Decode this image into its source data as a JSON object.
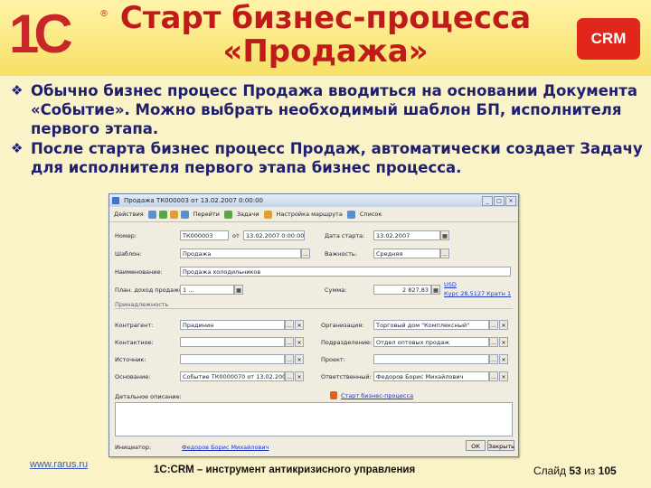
{
  "header": {
    "logo": "1С",
    "title_line1": "Старт бизнес-процесса",
    "title_line2": "«Продажа»",
    "badge": "CRM"
  },
  "bullets": [
    "Обычно бизнес процесс Продажа вводиться на основании Документа «Событие». Можно выбрать необходимый шаблон БП, исполнителя первого этапа.",
    "После старта бизнес процесс Продаж, автоматически создает Задачу для исполнителя первого этапа бизнес процесса."
  ],
  "window": {
    "title": "Продажа ТК000003 от 13.02.2007 0:00:00",
    "toolbar": {
      "actions": "Действия",
      "goto": "Перейти",
      "help": "Задачи",
      "route": "Настройка маршрута",
      "list": "Список"
    },
    "fields": {
      "number_label": "Номер:",
      "number_value": "ТК000003",
      "from_label": "от",
      "from_value": "13.02.2007 0:00:00",
      "start_date_label": "Дата старта:",
      "start_date_value": "13.02.2007",
      "template_label": "Шаблон:",
      "template_value": "Продажа",
      "importance_label": "Важность:",
      "importance_value": "Средняя",
      "name_label": "Наименование:",
      "name_value": "Продажа холодильников",
      "plan_label": "План. доход продажи:",
      "plan_value": "1 ...",
      "sum_label": "Сумма:",
      "sum_value": "2 827,83",
      "currency": "USD",
      "rate": "Курс 28,5127 Кратн 1"
    },
    "section_label": "Принадлежность",
    "assoc": {
      "counterparty_label": "Контрагент:",
      "counterparty_value": "Прадинин",
      "org_label": "Организация:",
      "org_value": "Торговый дом \"Комплексный\"",
      "contact_label": "Контактное:",
      "contact_value": "",
      "division_label": "Подразделение:",
      "division_value": "Отдел оптовых продаж",
      "source_label": "Источник:",
      "source_value": "",
      "project_label": "Проект:",
      "project_value": "",
      "basis_label": "Основание:",
      "basis_value": "Событие ТК0000070 от 13.02.2007",
      "responsible_label": "Ответственный:",
      "responsible_value": "Федоров Борис Михайлович",
      "details_label": "Детальное описание:",
      "start_link": "Старт бизнес-процесса"
    },
    "footer": {
      "initiator_label": "Инициатор:",
      "initiator_value": "Федоров Борис Михайлович",
      "ok": "ОК",
      "close": "Закрыть"
    }
  },
  "footer": {
    "link": "www.rarus.ru",
    "tagline": "1С:CRM – инструмент антикризисного управления",
    "slide_prefix": "Слайд",
    "slide_number": "53",
    "slide_of": "из",
    "slide_total": "105"
  }
}
